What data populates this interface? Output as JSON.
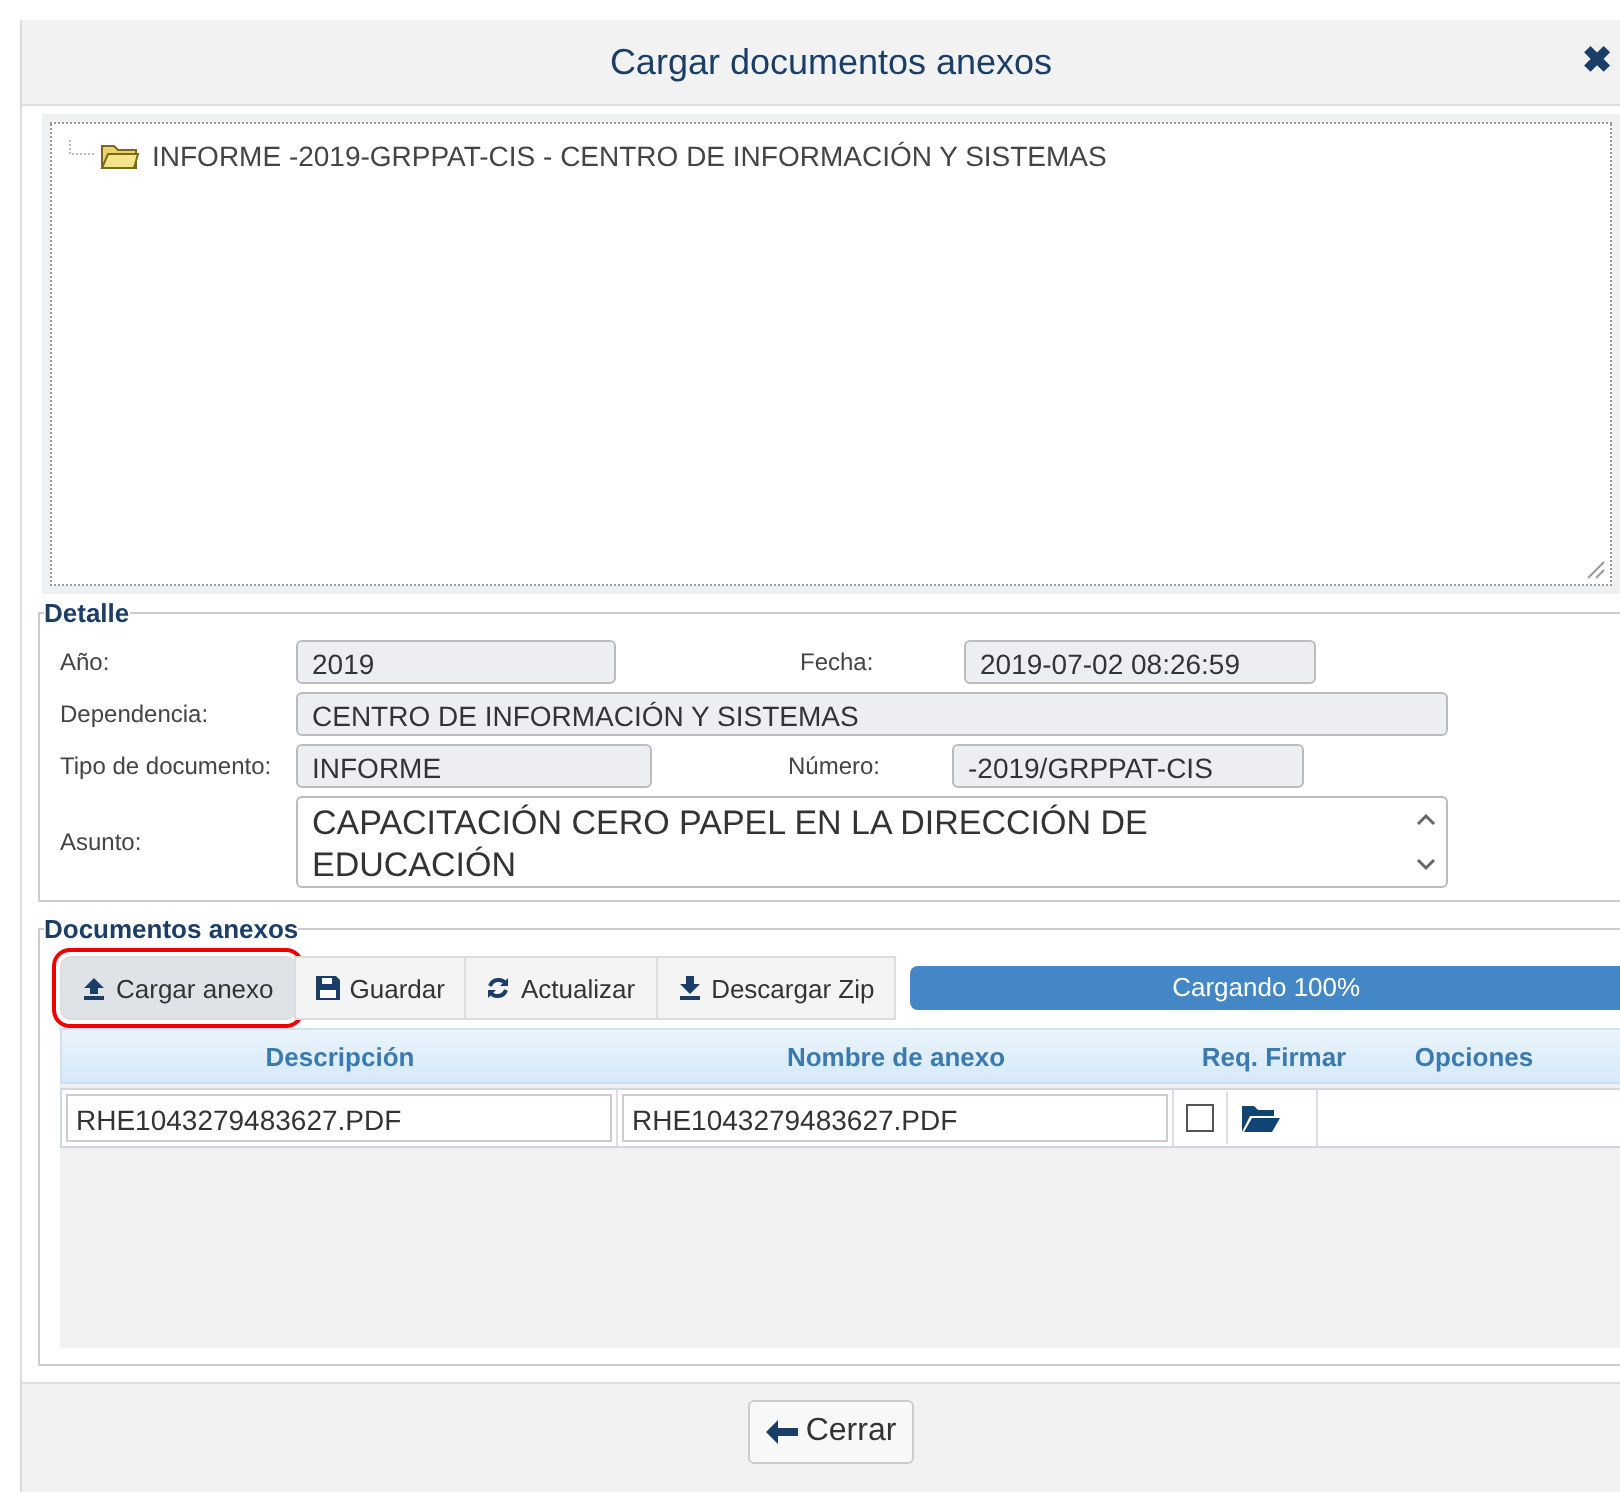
{
  "window": {
    "title": "Cargar documentos anexos",
    "close": "✖"
  },
  "tree": {
    "items": [
      {
        "label": "INFORME -2019-GRPPAT-CIS - CENTRO DE INFORMACIÓN Y SISTEMAS"
      }
    ]
  },
  "detalle": {
    "legend": "Detalle",
    "anio": {
      "label": "Año:",
      "value": "2019"
    },
    "fecha": {
      "label": "Fecha:",
      "value": "2019-07-02 08:26:59"
    },
    "dependencia": {
      "label": "Dependencia:",
      "value": "CENTRO DE INFORMACIÓN Y SISTEMAS"
    },
    "tipo": {
      "label": "Tipo de documento:",
      "value": "INFORME"
    },
    "numero": {
      "label": "Número:",
      "value": "-2019/GRPPAT-CIS"
    },
    "asunto": {
      "label": "Asunto:",
      "value": "CAPACITACIÓN CERO PAPEL EN LA DIRECCIÓN DE EDUCACIÓN"
    }
  },
  "anexos": {
    "legend": "Documentos anexos",
    "buttons": [
      {
        "label": "Cargar anexo",
        "kind": "upload",
        "highlighted": true
      },
      {
        "label": "Guardar",
        "kind": "save",
        "highlighted": false
      },
      {
        "label": "Actualizar",
        "kind": "refresh",
        "highlighted": false
      },
      {
        "label": "Descargar Zip",
        "kind": "download",
        "highlighted": false
      }
    ],
    "progress": {
      "label": "Cargando 100%",
      "level": 1
    },
    "columns": [
      "Descripción",
      "Nombre de anexo",
      "Req. Firmar",
      "Opciones"
    ],
    "rows": [
      {
        "descripcion": "RHE1043279483627.PDF",
        "nombre": "RHE1043279483627.PDF",
        "req_firmar": false
      }
    ]
  },
  "footer": {
    "button": "Cerrar"
  }
}
